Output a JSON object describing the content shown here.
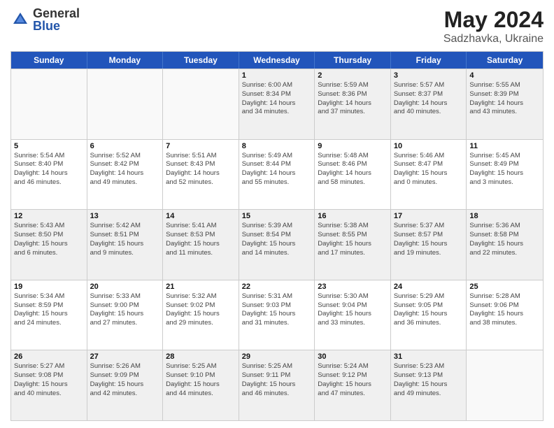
{
  "header": {
    "logo": {
      "general": "General",
      "blue": "Blue"
    },
    "title": "May 2024",
    "location": "Sadzhavka, Ukraine"
  },
  "days_of_week": [
    "Sunday",
    "Monday",
    "Tuesday",
    "Wednesday",
    "Thursday",
    "Friday",
    "Saturday"
  ],
  "weeks": [
    [
      {
        "day": "",
        "info": "",
        "empty": true
      },
      {
        "day": "",
        "info": "",
        "empty": true
      },
      {
        "day": "",
        "info": "",
        "empty": true
      },
      {
        "day": "1",
        "info": "Sunrise: 6:00 AM\nSunset: 8:34 PM\nDaylight: 14 hours\nand 34 minutes.",
        "empty": false
      },
      {
        "day": "2",
        "info": "Sunrise: 5:59 AM\nSunset: 8:36 PM\nDaylight: 14 hours\nand 37 minutes.",
        "empty": false
      },
      {
        "day": "3",
        "info": "Sunrise: 5:57 AM\nSunset: 8:37 PM\nDaylight: 14 hours\nand 40 minutes.",
        "empty": false
      },
      {
        "day": "4",
        "info": "Sunrise: 5:55 AM\nSunset: 8:39 PM\nDaylight: 14 hours\nand 43 minutes.",
        "empty": false
      }
    ],
    [
      {
        "day": "5",
        "info": "Sunrise: 5:54 AM\nSunset: 8:40 PM\nDaylight: 14 hours\nand 46 minutes.",
        "empty": false
      },
      {
        "day": "6",
        "info": "Sunrise: 5:52 AM\nSunset: 8:42 PM\nDaylight: 14 hours\nand 49 minutes.",
        "empty": false
      },
      {
        "day": "7",
        "info": "Sunrise: 5:51 AM\nSunset: 8:43 PM\nDaylight: 14 hours\nand 52 minutes.",
        "empty": false
      },
      {
        "day": "8",
        "info": "Sunrise: 5:49 AM\nSunset: 8:44 PM\nDaylight: 14 hours\nand 55 minutes.",
        "empty": false
      },
      {
        "day": "9",
        "info": "Sunrise: 5:48 AM\nSunset: 8:46 PM\nDaylight: 14 hours\nand 58 minutes.",
        "empty": false
      },
      {
        "day": "10",
        "info": "Sunrise: 5:46 AM\nSunset: 8:47 PM\nDaylight: 15 hours\nand 0 minutes.",
        "empty": false
      },
      {
        "day": "11",
        "info": "Sunrise: 5:45 AM\nSunset: 8:49 PM\nDaylight: 15 hours\nand 3 minutes.",
        "empty": false
      }
    ],
    [
      {
        "day": "12",
        "info": "Sunrise: 5:43 AM\nSunset: 8:50 PM\nDaylight: 15 hours\nand 6 minutes.",
        "empty": false
      },
      {
        "day": "13",
        "info": "Sunrise: 5:42 AM\nSunset: 8:51 PM\nDaylight: 15 hours\nand 9 minutes.",
        "empty": false
      },
      {
        "day": "14",
        "info": "Sunrise: 5:41 AM\nSunset: 8:53 PM\nDaylight: 15 hours\nand 11 minutes.",
        "empty": false
      },
      {
        "day": "15",
        "info": "Sunrise: 5:39 AM\nSunset: 8:54 PM\nDaylight: 15 hours\nand 14 minutes.",
        "empty": false
      },
      {
        "day": "16",
        "info": "Sunrise: 5:38 AM\nSunset: 8:55 PM\nDaylight: 15 hours\nand 17 minutes.",
        "empty": false
      },
      {
        "day": "17",
        "info": "Sunrise: 5:37 AM\nSunset: 8:57 PM\nDaylight: 15 hours\nand 19 minutes.",
        "empty": false
      },
      {
        "day": "18",
        "info": "Sunrise: 5:36 AM\nSunset: 8:58 PM\nDaylight: 15 hours\nand 22 minutes.",
        "empty": false
      }
    ],
    [
      {
        "day": "19",
        "info": "Sunrise: 5:34 AM\nSunset: 8:59 PM\nDaylight: 15 hours\nand 24 minutes.",
        "empty": false
      },
      {
        "day": "20",
        "info": "Sunrise: 5:33 AM\nSunset: 9:00 PM\nDaylight: 15 hours\nand 27 minutes.",
        "empty": false
      },
      {
        "day": "21",
        "info": "Sunrise: 5:32 AM\nSunset: 9:02 PM\nDaylight: 15 hours\nand 29 minutes.",
        "empty": false
      },
      {
        "day": "22",
        "info": "Sunrise: 5:31 AM\nSunset: 9:03 PM\nDaylight: 15 hours\nand 31 minutes.",
        "empty": false
      },
      {
        "day": "23",
        "info": "Sunrise: 5:30 AM\nSunset: 9:04 PM\nDaylight: 15 hours\nand 33 minutes.",
        "empty": false
      },
      {
        "day": "24",
        "info": "Sunrise: 5:29 AM\nSunset: 9:05 PM\nDaylight: 15 hours\nand 36 minutes.",
        "empty": false
      },
      {
        "day": "25",
        "info": "Sunrise: 5:28 AM\nSunset: 9:06 PM\nDaylight: 15 hours\nand 38 minutes.",
        "empty": false
      }
    ],
    [
      {
        "day": "26",
        "info": "Sunrise: 5:27 AM\nSunset: 9:08 PM\nDaylight: 15 hours\nand 40 minutes.",
        "empty": false
      },
      {
        "day": "27",
        "info": "Sunrise: 5:26 AM\nSunset: 9:09 PM\nDaylight: 15 hours\nand 42 minutes.",
        "empty": false
      },
      {
        "day": "28",
        "info": "Sunrise: 5:25 AM\nSunset: 9:10 PM\nDaylight: 15 hours\nand 44 minutes.",
        "empty": false
      },
      {
        "day": "29",
        "info": "Sunrise: 5:25 AM\nSunset: 9:11 PM\nDaylight: 15 hours\nand 46 minutes.",
        "empty": false
      },
      {
        "day": "30",
        "info": "Sunrise: 5:24 AM\nSunset: 9:12 PM\nDaylight: 15 hours\nand 47 minutes.",
        "empty": false
      },
      {
        "day": "31",
        "info": "Sunrise: 5:23 AM\nSunset: 9:13 PM\nDaylight: 15 hours\nand 49 minutes.",
        "empty": false
      },
      {
        "day": "",
        "info": "",
        "empty": true
      }
    ]
  ]
}
